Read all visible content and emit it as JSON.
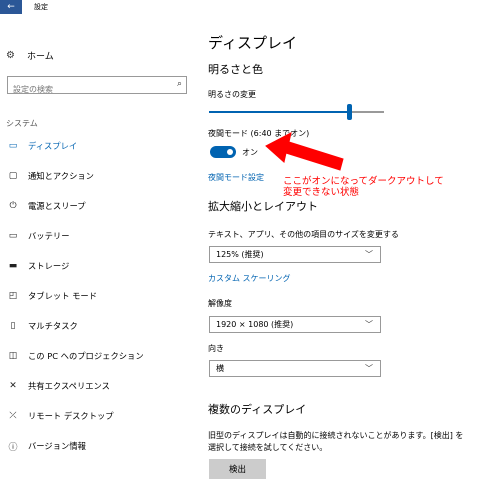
{
  "window": {
    "title": "設定",
    "back_icon": "arrow-left-icon"
  },
  "sidebar": {
    "home_label": "ホーム",
    "search_placeholder": "設定の検索",
    "section_label": "システム",
    "items": [
      {
        "label": "ディスプレイ",
        "icon": "monitor-icon",
        "active": true
      },
      {
        "label": "通知とアクション",
        "icon": "notification-icon"
      },
      {
        "label": "電源とスリープ",
        "icon": "power-icon"
      },
      {
        "label": "バッテリー",
        "icon": "battery-icon"
      },
      {
        "label": "ストレージ",
        "icon": "storage-icon"
      },
      {
        "label": "タブレット モード",
        "icon": "tablet-icon"
      },
      {
        "label": "マルチタスク",
        "icon": "multitask-icon"
      },
      {
        "label": "この PC へのプロジェクション",
        "icon": "projection-icon"
      },
      {
        "label": "共有エクスペリエンス",
        "icon": "shared-experience-icon"
      },
      {
        "label": "リモート デスクトップ",
        "icon": "remote-desktop-icon"
      },
      {
        "label": "バージョン情報",
        "icon": "info-icon"
      }
    ]
  },
  "main": {
    "title": "ディスプレイ",
    "brightness_heading": "明るさと色",
    "brightness_label": "明るさの変更",
    "brightness_level": 0.8,
    "night_light_label": "夜間モード (6:40 までオン)",
    "night_light_state": "オン",
    "night_light_settings_link": "夜間モード設定",
    "scale_heading": "拡大縮小とレイアウト",
    "scale_label": "テキスト、アプリ、その他の項目のサイズを変更する",
    "scale_value": "125% (推奨)",
    "custom_scaling_link": "カスタム スケーリング",
    "resolution_label": "解像度",
    "resolution_value": "1920 × 1080 (推奨)",
    "orientation_label": "向き",
    "orientation_value": "横",
    "multi_display_heading": "複数のディスプレイ",
    "multi_display_desc": "旧型のディスプレイは自動的に接続されないことがあります。[検出] を選択して接続を試してください。",
    "detect_button": "検出"
  },
  "annotation": {
    "line1": "ここがオンになってダークアウトして",
    "line2": "変更できない状態",
    "color": "#ff0000"
  },
  "colors": {
    "accent": "#0063b1",
    "back_button": "#2b5797",
    "annotation": "#ff0000"
  }
}
